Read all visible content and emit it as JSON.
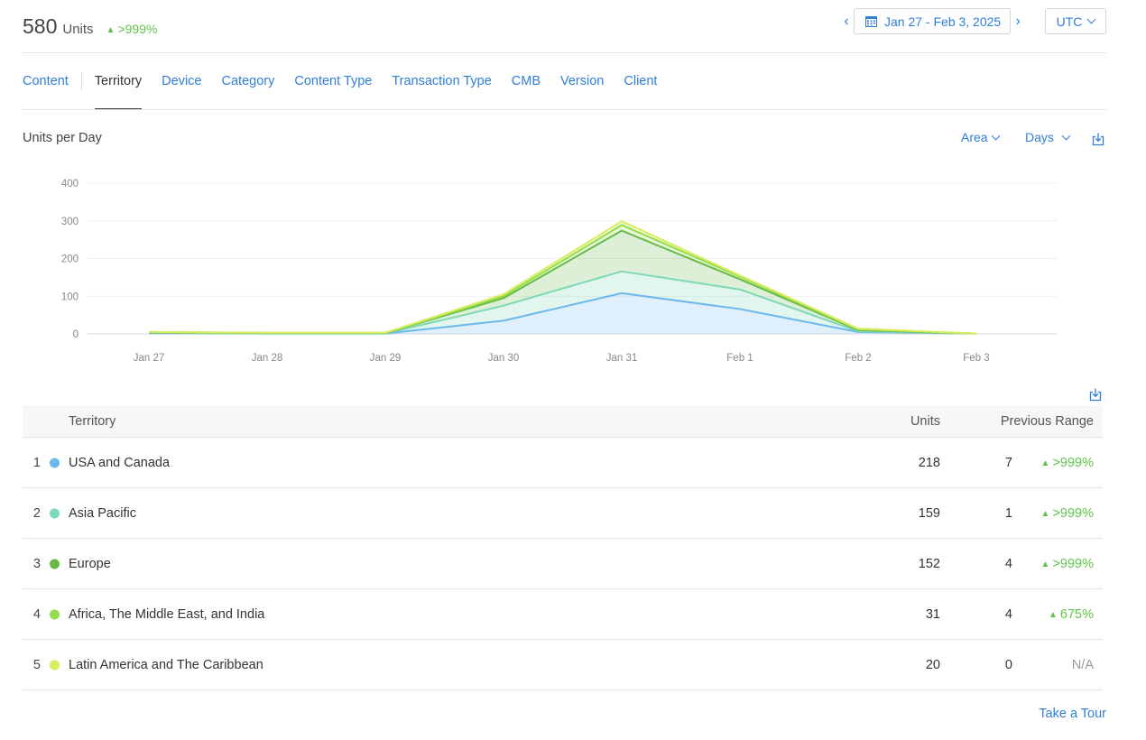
{
  "header": {
    "total_units": "580",
    "units_label": "Units",
    "change": ">999%",
    "date_range": "Jan 27 - Feb 3, 2025",
    "timezone": "UTC",
    "colors": {
      "accent": "#2f7ed8",
      "positive": "#5fc44a"
    }
  },
  "tabs": [
    {
      "label": "Content"
    },
    {
      "label": "Territory"
    },
    {
      "label": "Device"
    },
    {
      "label": "Category"
    },
    {
      "label": "Content Type"
    },
    {
      "label": "Transaction Type"
    },
    {
      "label": "CMB"
    },
    {
      "label": "Version"
    },
    {
      "label": "Client"
    }
  ],
  "active_tab": "Territory",
  "chart": {
    "title": "Units per Day",
    "type_selector": "Area",
    "interval_selector": "Days"
  },
  "chart_data": {
    "type": "area",
    "stacked": true,
    "x": [
      "Jan 27",
      "Jan 28",
      "Jan 29",
      "Jan 30",
      "Jan 31",
      "Feb 1",
      "Feb 2",
      "Feb 3"
    ],
    "ylim": [
      0,
      400
    ],
    "yticks": [
      0,
      100,
      200,
      300,
      400
    ],
    "grid": true,
    "series": [
      {
        "name": "USA and Canada",
        "color": "#6cb8ec",
        "values": [
          2,
          1,
          1,
          35,
          108,
          66,
          5,
          1
        ]
      },
      {
        "name": "Asia Pacific",
        "color": "#7dd8b5",
        "values": [
          1,
          0,
          0,
          40,
          58,
          52,
          2,
          0
        ]
      },
      {
        "name": "Europe",
        "color": "#66bb47",
        "values": [
          1,
          1,
          1,
          20,
          108,
          27,
          3,
          0
        ]
      },
      {
        "name": "Africa, The Middle East, and India",
        "color": "#93dc4c",
        "values": [
          1,
          1,
          1,
          5,
          15,
          7,
          2,
          0
        ]
      },
      {
        "name": "Latin America and The Caribbean",
        "color": "#d8ec5e",
        "values": [
          0,
          0,
          0,
          5,
          10,
          3,
          2,
          0
        ]
      }
    ]
  },
  "table": {
    "headers": {
      "territory": "Territory",
      "units": "Units",
      "previous": "Previous Range"
    },
    "rows": [
      {
        "rank": "1",
        "name": "USA and Canada",
        "units": "218",
        "previous": "7",
        "change": ">999%",
        "color": "#6cb8ec"
      },
      {
        "rank": "2",
        "name": "Asia Pacific",
        "units": "159",
        "previous": "1",
        "change": ">999%",
        "color": "#7dd8b5"
      },
      {
        "rank": "3",
        "name": "Europe",
        "units": "152",
        "previous": "4",
        "change": ">999%",
        "color": "#66bb47"
      },
      {
        "rank": "4",
        "name": "Africa, The Middle East, and India",
        "units": "31",
        "previous": "4",
        "change": "675%",
        "color": "#93dc4c"
      },
      {
        "rank": "5",
        "name": "Latin America and The Caribbean",
        "units": "20",
        "previous": "0",
        "change": "N/A",
        "color": "#d8ec5e"
      }
    ]
  },
  "footer": {
    "tour_link": "Take a Tour"
  }
}
